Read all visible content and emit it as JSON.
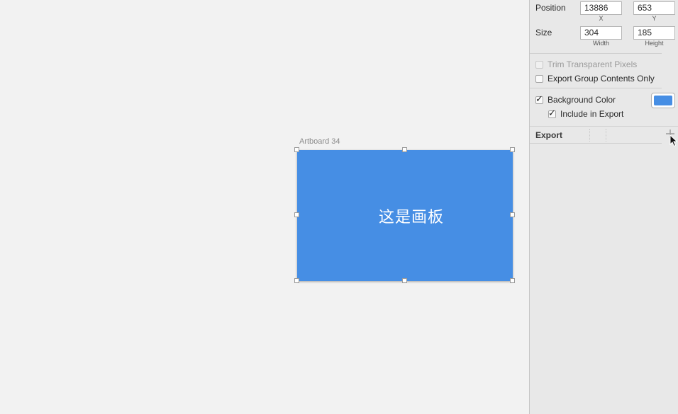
{
  "canvas": {
    "artboard_title": "Artboard 34",
    "artboard_text": "这是画板",
    "artboard_color": "#468ee4"
  },
  "inspector": {
    "position": {
      "label": "Position",
      "x_value": "13886",
      "x_caption": "X",
      "y_value": "653",
      "y_caption": "Y"
    },
    "size": {
      "label": "Size",
      "width_value": "304",
      "width_caption": "Width",
      "height_value": "185",
      "height_caption": "Height"
    },
    "trim_transparent_pixels": {
      "label": "Trim Transparent Pixels",
      "checked": false,
      "enabled": false
    },
    "export_group_contents_only": {
      "label": "Export Group Contents Only",
      "checked": false
    },
    "background_color": {
      "label": "Background Color",
      "checked": true,
      "color": "#468ee4"
    },
    "include_in_export": {
      "label": "Include in Export",
      "checked": true
    },
    "export": {
      "label": "Export",
      "add_icon": "plus-icon"
    }
  },
  "cursor": {
    "icon": "arrow-cursor-icon"
  }
}
